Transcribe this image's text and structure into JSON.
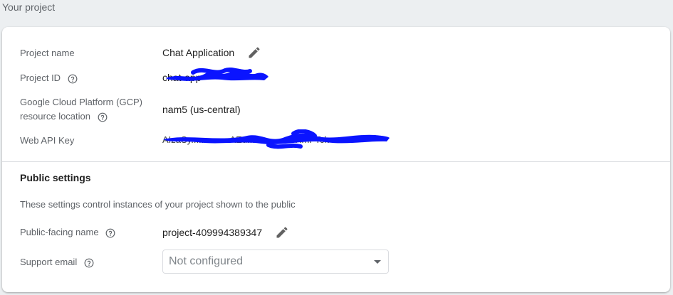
{
  "section_title": "Your project",
  "project": {
    "name_label": "Project name",
    "name_value": "Chat Application",
    "id_label": "Project ID",
    "id_value": "chat-app",
    "gcp_label_line1": "Google Cloud Platform (GCP)",
    "gcp_label_line2": "resource location",
    "gcp_value": "nam5 (us-central)",
    "api_key_label": "Web API Key",
    "api_key_value": "AIzaSy...............AEd...............oJXmFTck"
  },
  "public_settings": {
    "heading": "Public settings",
    "description": "These settings control instances of your project shown to the public",
    "public_name_label": "Public-facing name",
    "public_name_value": "project-409994389347",
    "support_email_label": "Support email",
    "support_email_placeholder": "Not configured"
  },
  "colors": {
    "background": "#eceff1",
    "card": "#ffffff",
    "label": "#5f6368",
    "text": "#212121",
    "redaction": "#0a14ff"
  },
  "icons": {
    "edit": "pencil-icon",
    "help": "help-circle-icon",
    "dropdown": "caret-down-icon"
  }
}
